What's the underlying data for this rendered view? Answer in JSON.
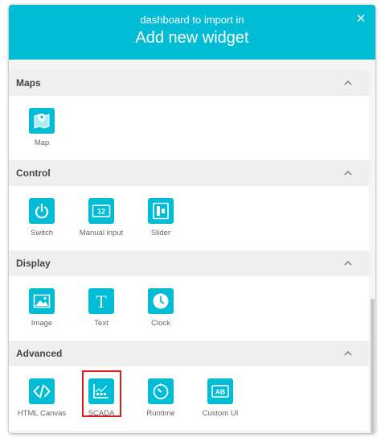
{
  "dialog": {
    "subtitle": "dashboard to import in",
    "title": "Add new widget",
    "close_icon": "close-icon"
  },
  "sections": [
    {
      "label": "Maps",
      "icon": "chevron-up-icon",
      "widgets": [
        {
          "label": "Map",
          "icon": "map-pin-icon"
        }
      ]
    },
    {
      "label": "Control",
      "icon": "chevron-up-icon",
      "widgets": [
        {
          "label": "Switch",
          "icon": "power-icon"
        },
        {
          "label": "Manual input",
          "icon": "numeric-input-icon",
          "icon_text": "12"
        },
        {
          "label": "Slider",
          "icon": "slider-icon"
        }
      ]
    },
    {
      "label": "Display",
      "icon": "chevron-up-icon",
      "widgets": [
        {
          "label": "Image",
          "icon": "image-icon"
        },
        {
          "label": "Text",
          "icon": "text-icon",
          "icon_text": "T"
        },
        {
          "label": "Clock",
          "icon": "clock-icon"
        }
      ]
    },
    {
      "label": "Advanced",
      "icon": "chevron-up-icon",
      "widgets": [
        {
          "label": "HTML Canvas",
          "icon": "code-icon"
        },
        {
          "label": "SCADA",
          "icon": "scada-icon",
          "highlighted": true
        },
        {
          "label": "Runtime",
          "icon": "timer-icon"
        },
        {
          "label": "Custom UI",
          "icon": "custom-ui-icon",
          "icon_text": "AB"
        }
      ]
    }
  ],
  "colors": {
    "accent": "#00bcd4",
    "highlight": "#e01b1b"
  }
}
